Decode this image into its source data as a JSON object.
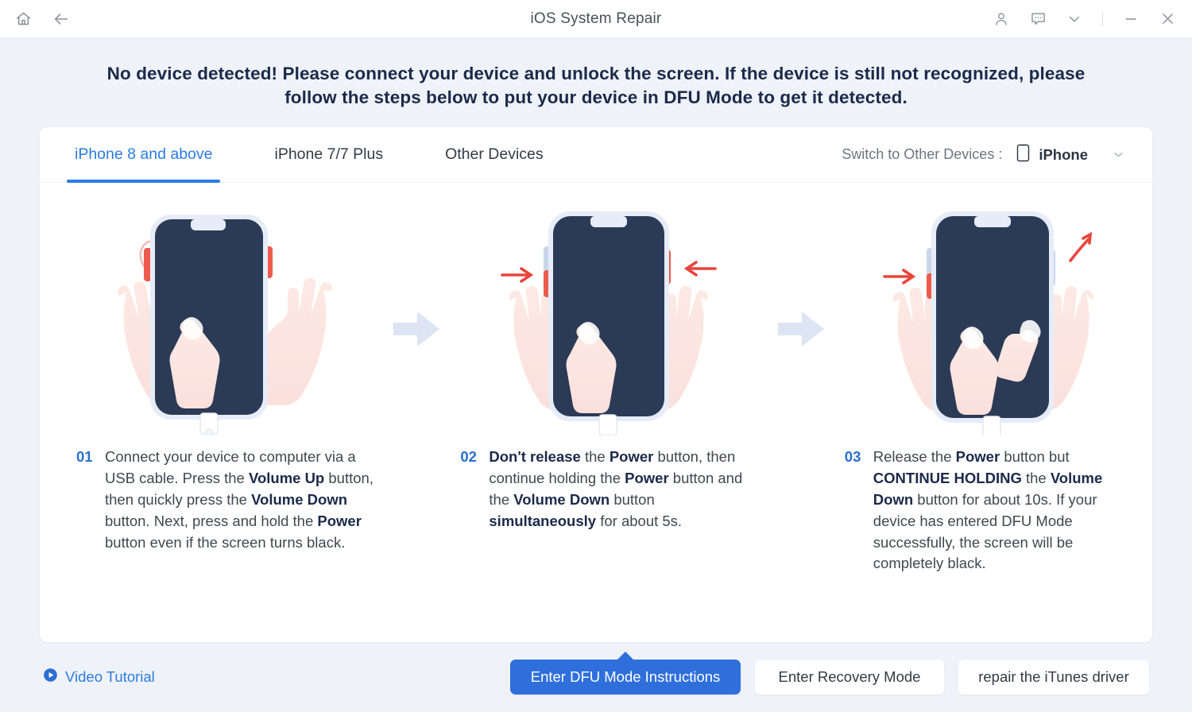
{
  "titlebar": {
    "title": "iOS System Repair",
    "home_icon": "home-icon",
    "back_icon": "back-arrow-icon",
    "account_icon": "account-icon",
    "feedback_icon": "message-bubble-icon",
    "more_icon": "chevron-down-icon",
    "minimize_icon": "minimize-icon",
    "close_icon": "close-icon"
  },
  "headline": {
    "line1": "No device detected! Please connect your device and unlock the screen. If the device is still not recognized, please",
    "line2": "follow the steps below to put your device in DFU Mode to get it detected."
  },
  "tabs": [
    {
      "label": "iPhone 8 and above",
      "active": true
    },
    {
      "label": "iPhone 7/7 Plus",
      "active": false
    },
    {
      "label": "Other Devices",
      "active": false
    }
  ],
  "switcher": {
    "label": "Switch to Other Devices :",
    "device_icon": "phone-icon",
    "selected": "iPhone",
    "chevron_icon": "chevron-down-icon"
  },
  "steps": [
    {
      "number": "01",
      "text_html": "Connect your device to computer via a USB cable. Press the <b>Volume Up</b> button, then quickly press the <b>Volume Down</b> button. Next, press and hold the <b>Power</b> button even if the screen turns black."
    },
    {
      "number": "02",
      "text_html": "<b>Don't release</b> the <b>Power</b> button, then continue holding the <b>Power</b> button and the <b>Volume Down</b> button <b>simultaneously</b> for about 5s."
    },
    {
      "number": "03",
      "text_html": "Release the <b>Power</b> button but <b>CONTINUE HOLDING</b> the <b>Volume Down</b> button for about 10s. If your device has entered DFU Mode successfully, the screen will be completely black."
    }
  ],
  "bottom": {
    "video_tutorial": "Video Tutorial",
    "play_icon": "play-icon",
    "buttons": [
      {
        "label": "Enter DFU Mode Instructions",
        "primary": true
      },
      {
        "label": "Enter Recovery Mode",
        "primary": false
      },
      {
        "label": "repair the iTunes driver",
        "primary": false
      }
    ]
  },
  "colors": {
    "accent": "#2b7de0",
    "primary_button": "#2f6fdc",
    "page_background": "#eff2f8",
    "card_background": "#ffffff",
    "headline_text": "#1b2a4a",
    "phone_screen": "#2b3a55",
    "highlight_red": "#e8453c"
  }
}
